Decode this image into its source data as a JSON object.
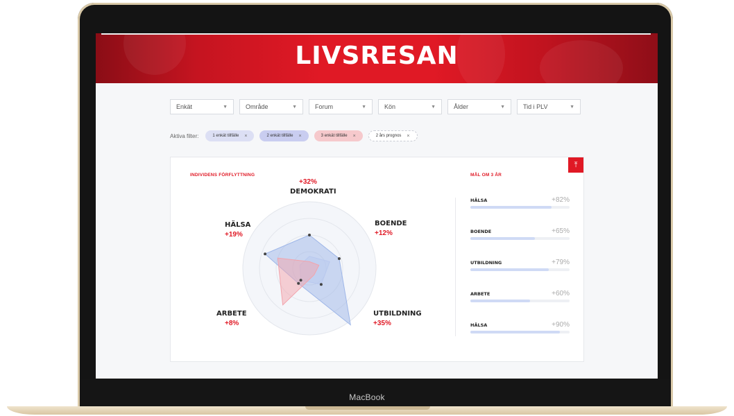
{
  "device": {
    "label": "MacBook"
  },
  "hero": {
    "title": "LIVSRESAN"
  },
  "filters": [
    {
      "label": "Enkät"
    },
    {
      "label": "Område"
    },
    {
      "label": "Forum"
    },
    {
      "label": "Kön"
    },
    {
      "label": "Ålder"
    },
    {
      "label": "Tid i PLV"
    }
  ],
  "active_filters": {
    "label": "Aktiva filter:",
    "chips": [
      {
        "label": "1 enkät tillfälle",
        "color": "#dcdff4"
      },
      {
        "label": "2 enkät tillfälle",
        "color": "#c9cdf0"
      },
      {
        "label": "3 enkät tillfälle",
        "color": "#f6c9cc"
      },
      {
        "label": "2 års prognos",
        "color": "#ffffff"
      }
    ]
  },
  "card": {
    "left_title": "INDIVIDENS FÖRFLYTTNING",
    "right_title": "MÅL OM 3 ÅR",
    "export_icon": "upload-icon",
    "radar": {
      "axes": [
        {
          "name": "DEMOKRATI",
          "pct": "+32%"
        },
        {
          "name": "BOENDE",
          "pct": "+12%"
        },
        {
          "name": "UTBILDNING",
          "pct": "+35%"
        },
        {
          "name": "ARBETE",
          "pct": "+8%"
        },
        {
          "name": "HÄLSA",
          "pct": "+19%"
        }
      ],
      "series": [
        {
          "color": "#9eb6e8",
          "values": [
            0.5,
            0.47,
            1.05,
            0.28,
            0.7
          ]
        },
        {
          "color": "#b9c9ef",
          "values": [
            0.18,
            0.32,
            0.3,
            0.22,
            0.15
          ]
        },
        {
          "color": "#f3a3ab",
          "values": [
            0.1,
            0.15,
            0.12,
            0.68,
            0.5
          ]
        }
      ]
    },
    "goals": [
      {
        "label": "HÄLSA",
        "value": "+82%",
        "fill": 0.82
      },
      {
        "label": "BOENDE",
        "value": "+65%",
        "fill": 0.65
      },
      {
        "label": "UTBILDNING",
        "value": "+79%",
        "fill": 0.79
      },
      {
        "label": "ARBETE",
        "value": "+60%",
        "fill": 0.6
      },
      {
        "label": "HÄLSA",
        "value": "+90%",
        "fill": 0.9
      }
    ]
  }
}
